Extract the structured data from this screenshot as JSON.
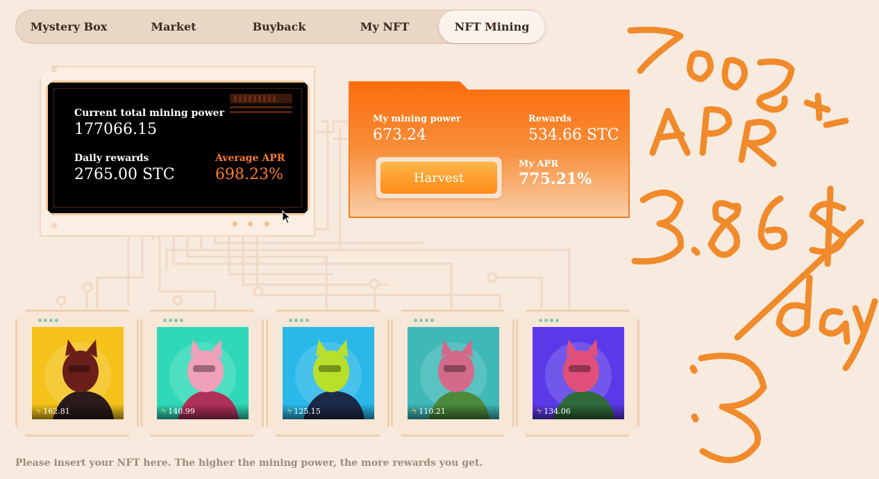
{
  "tabs": [
    {
      "label": "Mystery Box",
      "active": false
    },
    {
      "label": "Market",
      "active": false
    },
    {
      "label": "Buyback",
      "active": false
    },
    {
      "label": "My NFT",
      "active": false
    },
    {
      "label": "NFT Mining",
      "active": true
    }
  ],
  "pool": {
    "total_power_label": "Current total mining power",
    "total_power_value": "177066.15",
    "daily_rewards_label": "Daily rewards",
    "daily_rewards_value": "2765.00 STC",
    "avg_apr_label": "Average APR",
    "avg_apr_value": "698.23%"
  },
  "mine": {
    "power_label": "My mining power",
    "power_value": "673.24",
    "rewards_label": "Rewards",
    "rewards_value": "534.66 STC",
    "harvest_label": "Harvest",
    "apr_label": "My APR",
    "apr_value": "775.21%"
  },
  "nfts": [
    {
      "power": "162.81",
      "bg": "#f4c21a",
      "body": "#2a1a1a",
      "head": "#6b1f1a"
    },
    {
      "power": "140.99",
      "bg": "#2fd9b8",
      "body": "#b0305a",
      "head": "#f0a0b8"
    },
    {
      "power": "125.15",
      "bg": "#29b8e8",
      "body": "#1d2a4a",
      "head": "#b8e02a"
    },
    {
      "power": "110.21",
      "bg": "#3fb8b8",
      "body": "#4a8a3a",
      "head": "#d46a8a"
    },
    {
      "power": "134.06",
      "bg": "#5a3ae8",
      "body": "#2f6a3a",
      "head": "#e0507a"
    }
  ],
  "hint": "Please insert your NFT here. The higher the mining power, the more rewards you get.",
  "handwritten_note": [
    "700%+",
    "APR",
    "3.86$",
    "/day",
    ":3"
  ],
  "colors": {
    "accent_orange": "#fb6d0b",
    "background": "#f7eadf",
    "scribble": "#f08a2a"
  }
}
